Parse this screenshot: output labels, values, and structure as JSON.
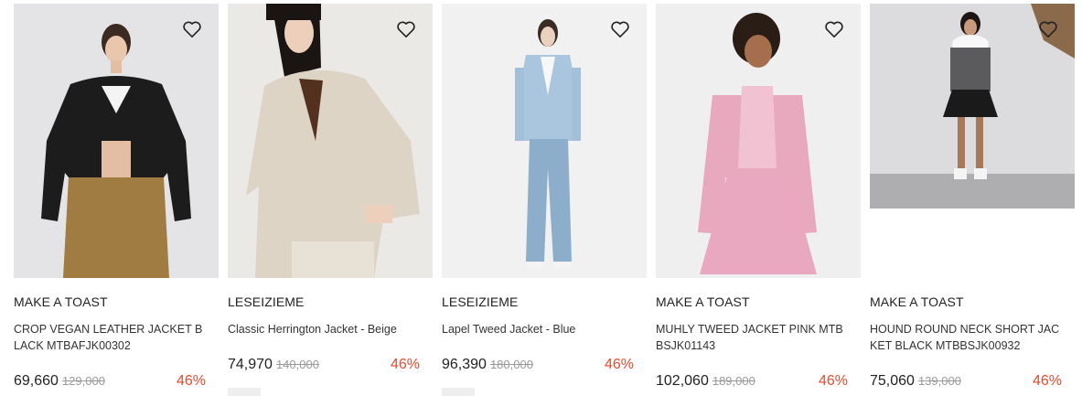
{
  "products": [
    {
      "brand": "MAKE A TOAST",
      "name": "CROP VEGAN LEATHER JACKET BLACK MTBAFJK00302",
      "price": "69,660",
      "original_price": "129,000",
      "discount": "46%",
      "image": "model-black-leather-jacket"
    },
    {
      "brand": "LESEIZIEME",
      "name": "Classic Herrington Jacket - Beige",
      "price": "74,970",
      "original_price": "140,000",
      "discount": "46%",
      "image": "model-beige-jacket"
    },
    {
      "brand": "LESEIZIEME",
      "name": "Lapel Tweed Jacket - Blue",
      "price": "96,390",
      "original_price": "180,000",
      "discount": "46%",
      "image": "model-blue-tweed-jacket"
    },
    {
      "brand": "MAKE A TOAST",
      "name": "MUHLY TWEED JACKET PINK MTBBSJK01143",
      "price": "102,060",
      "original_price": "189,000",
      "discount": "46%",
      "image": "model-pink-tweed-set"
    },
    {
      "brand": "MAKE A TOAST",
      "name": "HOUND ROUND NECK SHORT JACKET BLACK MTBBSJK00932",
      "price": "75,060",
      "original_price": "139,000",
      "discount": "46%",
      "image": "model-houndstooth-jacket"
    }
  ],
  "colors": {
    "discount": "#e8492a",
    "strike": "#9a9a9a"
  },
  "icons": {
    "wishlist": "heart-outline-icon"
  }
}
